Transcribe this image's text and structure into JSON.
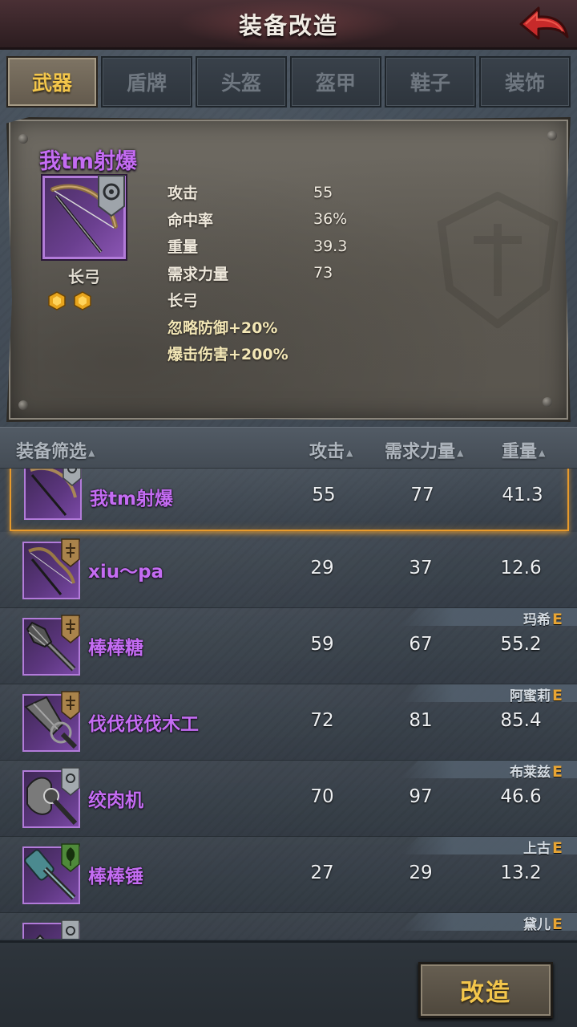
{
  "header": {
    "title": "装备改造"
  },
  "tabs": [
    {
      "label": "武器",
      "active": true
    },
    {
      "label": "盾牌",
      "active": false
    },
    {
      "label": "头盔",
      "active": false
    },
    {
      "label": "盔甲",
      "active": false
    },
    {
      "label": "鞋子",
      "active": false
    },
    {
      "label": "装饰",
      "active": false
    }
  ],
  "detail": {
    "name": "我tm射爆",
    "type": "长弓",
    "icon": "longbow-icon",
    "badge_icon": "silver-eye-badge-icon",
    "gems": 2,
    "stats": [
      {
        "label": "攻击",
        "value": "55"
      },
      {
        "label": "命中率",
        "value": "36%"
      },
      {
        "label": "重量",
        "value": "39.3"
      },
      {
        "label": "需求力量",
        "value": "73"
      }
    ],
    "extras": [
      "长弓",
      "忽略防御+20%",
      "爆击伤害+200%"
    ]
  },
  "list_header": {
    "filter": "装备筛选",
    "attack": "攻击",
    "strength": "需求力量",
    "weight": "重量"
  },
  "items": [
    {
      "name": "我tm射爆",
      "attack": "55",
      "strength": "77",
      "weight": "41.3",
      "owner": "",
      "grade": "",
      "icon": "longbow-icon",
      "badge": "silver",
      "selected": true
    },
    {
      "name": "xiu～pa",
      "attack": "29",
      "strength": "37",
      "weight": "12.6",
      "owner": "",
      "grade": "",
      "icon": "recurve-bow-icon",
      "badge": "bronze"
    },
    {
      "name": "棒棒糖",
      "attack": "59",
      "strength": "67",
      "weight": "55.2",
      "owner": "玛希",
      "grade": "E",
      "icon": "mace-icon",
      "badge": "bronze"
    },
    {
      "name": "伐伐伐伐木工",
      "attack": "72",
      "strength": "81",
      "weight": "85.4",
      "owner": "阿蜜莉",
      "grade": "E",
      "icon": "greatsword-icon",
      "badge": "bronze"
    },
    {
      "name": "绞肉机",
      "attack": "70",
      "strength": "97",
      "weight": "46.6",
      "owner": "布莱兹",
      "grade": "E",
      "icon": "battle-axe-icon",
      "badge": "silver"
    },
    {
      "name": "棒棒锤",
      "attack": "27",
      "strength": "29",
      "weight": "13.2",
      "owner": "上古",
      "grade": "E",
      "icon": "hammer-icon",
      "badge": "green"
    },
    {
      "name": "",
      "attack": "",
      "strength": "",
      "weight": "",
      "owner": "黛儿",
      "grade": "E",
      "icon": "dagger-icon",
      "badge": "silver"
    }
  ],
  "footer": {
    "modify_label": "改造"
  },
  "colors": {
    "epic_purple": "#c46cf2",
    "gold_text": "#f3c64b",
    "selection_orange": "#e79a2c",
    "grade_orange": "#e9a533"
  }
}
